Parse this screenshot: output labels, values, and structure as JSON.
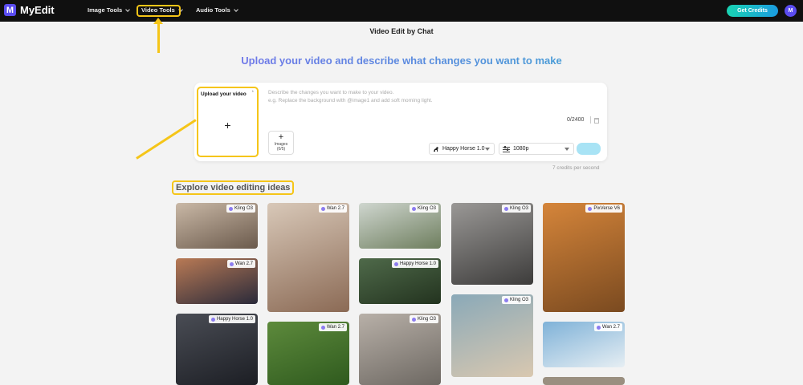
{
  "nav": {
    "logo_text": "MyEdit",
    "logo_mark": "M",
    "items": [
      {
        "label": "Image Tools"
      },
      {
        "label": "Video Tools"
      },
      {
        "label": "Audio Tools"
      }
    ],
    "cta": "Get Credits",
    "avatar": "M"
  },
  "page": {
    "title": "Video Edit by Chat",
    "headline": "Upload your video and describe what changes you want to make"
  },
  "editor": {
    "upload_label": "Upload your video",
    "upload_required": "*",
    "upload_plus": "+",
    "placeholder_line1": "Describe the changes you want to make to your video.",
    "placeholder_line2": "e.g. Replace the background with @image1 and add soft morning light.",
    "counter": "0/2400",
    "images_plus": "+",
    "images_label": "Images",
    "images_count": "(0/5)",
    "model": "Happy Horse 1.0",
    "resolution": "1080p",
    "credits_note": "7 credits per second"
  },
  "explore": {
    "title": "Explore video editing ideas",
    "tiles": [
      {
        "tag": "Kling O3",
        "colors": [
          "#c9b8a6",
          "#6b5a4c"
        ]
      },
      {
        "tag": "Wan 2.7",
        "colors": [
          "#b97a55",
          "#2a2a3a"
        ]
      },
      {
        "tag": "Happy Horse 1.0",
        "colors": [
          "#4a4d55",
          "#1c1e24"
        ]
      },
      {
        "tag": "Wan 2.7",
        "colors": [
          "#d8c8b8",
          "#8b6a55"
        ]
      },
      {
        "tag": "Wan 2.7",
        "colors": [
          "#5d8a3c",
          "#2f5a1e"
        ]
      },
      {
        "tag": "Kling O3",
        "colors": [
          "#cfd6cf",
          "#6e7e5e"
        ]
      },
      {
        "tag": "Happy Horse 1.0",
        "colors": [
          "#4f6a4a",
          "#23331f"
        ]
      },
      {
        "tag": "Kling O3",
        "colors": [
          "#b8b0a8",
          "#6d6862"
        ]
      },
      {
        "tag": "Kling O3",
        "colors": [
          "#9a9896",
          "#3d3c3b"
        ]
      },
      {
        "tag": "Kling O3",
        "colors": [
          "#8aa9b8",
          "#d9c8b0"
        ]
      },
      {
        "tag": "PixVerse V6",
        "colors": [
          "#d5853a",
          "#7a4a20"
        ]
      },
      {
        "tag": "Wan 2.7",
        "colors": [
          "#7fb2d8",
          "#e6eef3"
        ]
      }
    ]
  }
}
